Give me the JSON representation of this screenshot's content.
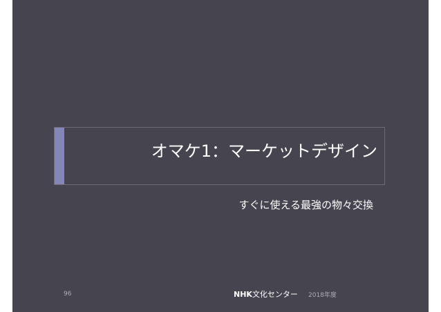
{
  "slide": {
    "title": "オマケ1：マーケットデザイン",
    "subtitle": "すぐに使える最強の物々交換",
    "footer": {
      "page_number": "96",
      "brand": "NHK",
      "org": "文化センター",
      "year": "2018年度"
    }
  },
  "colors": {
    "background": "#45444f",
    "accent": "#8486b8",
    "text": "#ffffff"
  }
}
